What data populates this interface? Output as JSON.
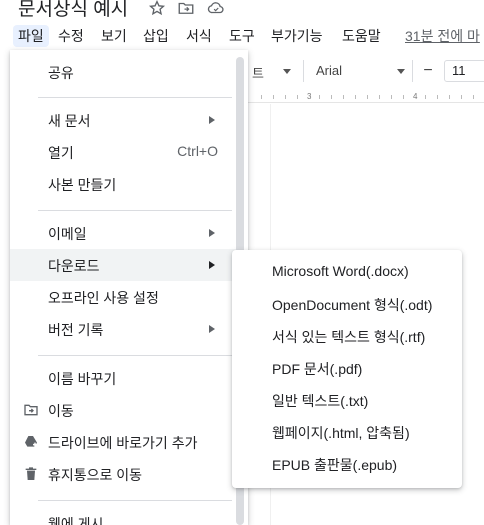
{
  "title_bar": {
    "doc_title": "문서상식 예시",
    "icons": [
      "star-icon",
      "move-to-folder-icon",
      "cloud-status-icon"
    ]
  },
  "menubar": {
    "items": [
      "파일",
      "수정",
      "보기",
      "삽입",
      "서식",
      "도구",
      "부가기능",
      "도움말"
    ],
    "active_item": "파일",
    "last_edit": "31분 전에 마"
  },
  "toolbar": {
    "style_tail": "트",
    "font": "Arial",
    "minus": "−",
    "font_size": "11"
  },
  "ruler": {
    "marks": [
      "3",
      "4"
    ]
  },
  "file_menu": {
    "share": "공유",
    "new_doc": "새 문서",
    "open": "열기",
    "open_shortcut": "Ctrl+O",
    "make_copy": "사본 만들기",
    "email": "이메일",
    "download": "다운로드",
    "offline": "오프라인 사용 설정",
    "version_history": "버전 기록",
    "rename": "이름 바꾸기",
    "move": "이동",
    "add_shortcut": "드라이브에 바로가기 추가",
    "trash": "휴지통으로 이동",
    "publish": "웹에 게시",
    "icons": [
      "move-icon",
      "drive-shortcut-icon",
      "trash-icon"
    ]
  },
  "download_submenu": {
    "items": [
      "Microsoft Word(.docx)",
      "OpenDocument 형식(.odt)",
      "서식 있는 텍스트 형식(.rtf)",
      "PDF 문서(.pdf)",
      "일반 텍스트(.txt)",
      "웹페이지(.html, 압축됨)",
      "EPUB 출판물(.epub)"
    ]
  },
  "colors": {
    "menu_highlight": "#f1f3f4",
    "active_menu_bg": "#e8f0fe",
    "text": "#202124",
    "secondary_text": "#5f6368"
  }
}
